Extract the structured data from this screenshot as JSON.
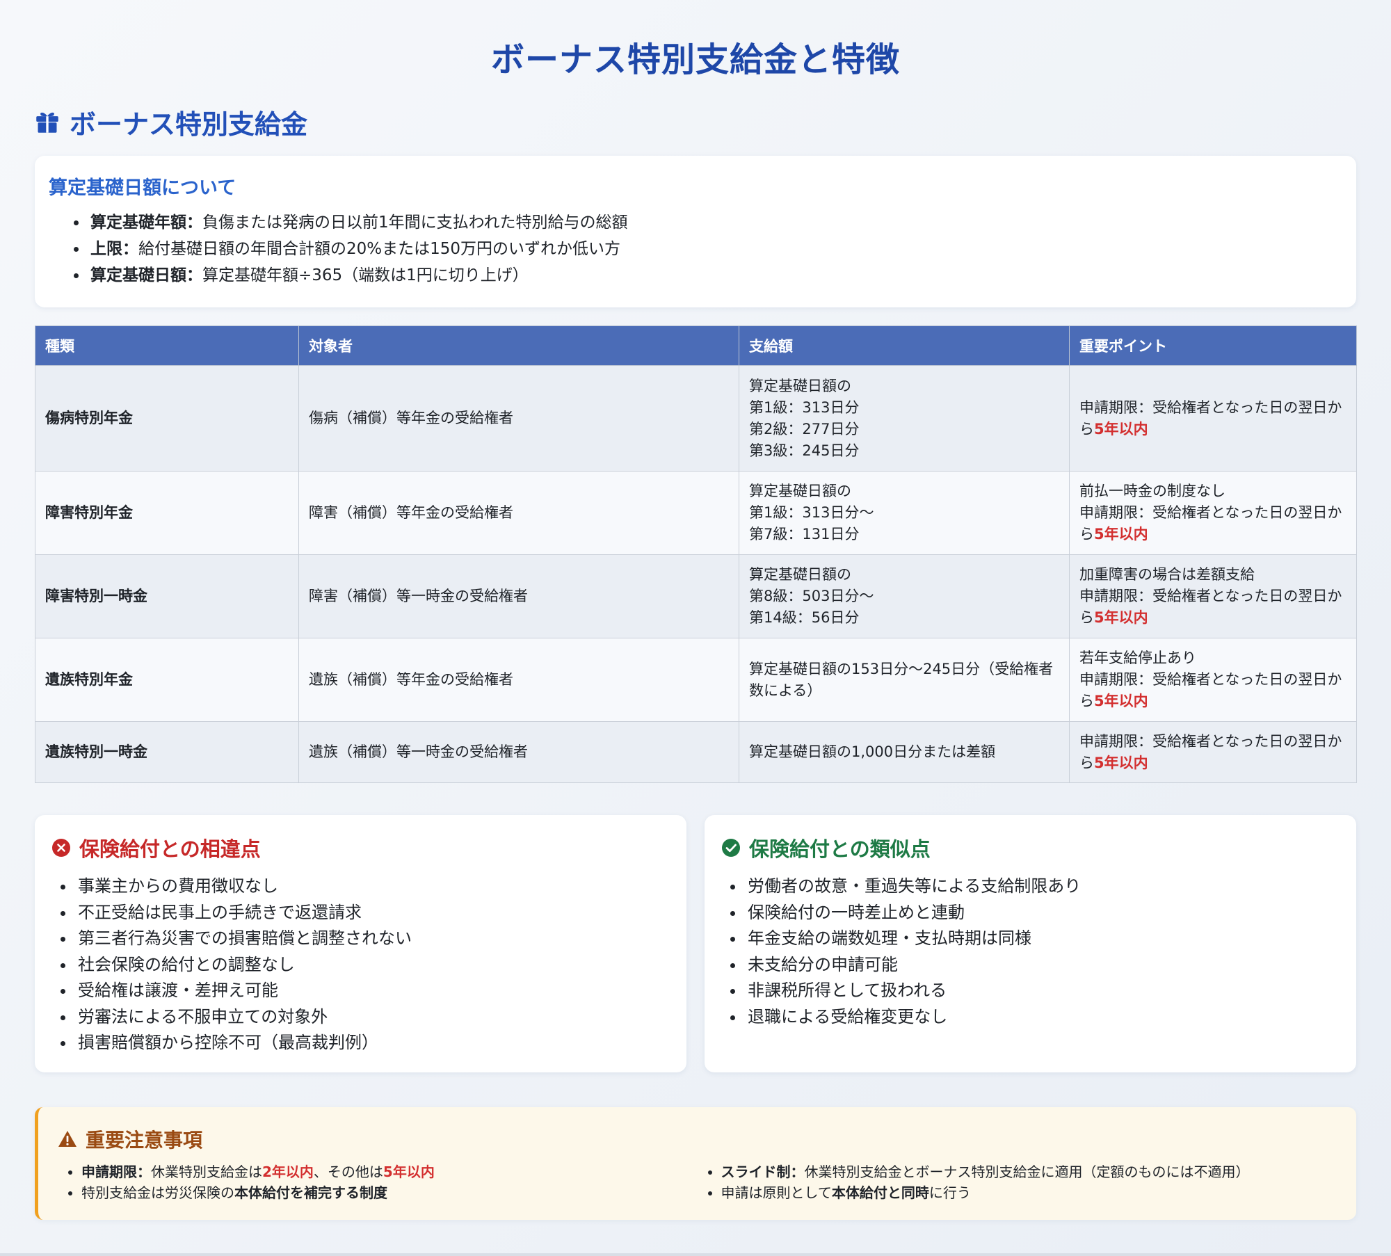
{
  "page_title": "ボーナス特別支給金と特徴",
  "section": {
    "title": "ボーナス特別支給金",
    "icon": "gift-icon"
  },
  "basis": {
    "title": "算定基礎日額について",
    "items": [
      {
        "term": "算定基礎年額",
        "sep": "：",
        "text": "負傷または発病の日以前1年間に支払われた特別給与の総額"
      },
      {
        "term": "上限",
        "sep": "：",
        "text": "給付基礎日額の年間合計額の20%または150万円のいずれか低い方"
      },
      {
        "term": "算定基礎日額",
        "sep": "：",
        "text": "算定基礎年額÷365（端数は1円に切り上げ）"
      }
    ]
  },
  "table": {
    "headers": [
      "種類",
      "対象者",
      "支給額",
      "重要ポイント"
    ],
    "rows": [
      {
        "type": "傷病特別年金",
        "target": "傷病（補償）等年金の受給権者",
        "amount": [
          "算定基礎日額の",
          "第1級：313日分",
          "第2級：277日分",
          "第3級：245日分"
        ],
        "note_lines": [],
        "deadline_prefix": "申請期限：受給権者となった日の翌日から",
        "deadline_value": "5年以内"
      },
      {
        "type": "障害特別年金",
        "target": "障害（補償）等年金の受給権者",
        "amount": [
          "算定基礎日額の",
          "第1級：313日分〜",
          "第7級：131日分"
        ],
        "note_lines": [
          "前払一時金の制度なし"
        ],
        "deadline_prefix": "申請期限：受給権者となった日の翌日から",
        "deadline_value": "5年以内"
      },
      {
        "type": "障害特別一時金",
        "target": "障害（補償）等一時金の受給権者",
        "amount": [
          "算定基礎日額の",
          "第8級：503日分〜",
          "第14級：56日分"
        ],
        "note_lines": [
          "加重障害の場合は差額支給"
        ],
        "deadline_prefix": "申請期限：受給権者となった日の翌日から",
        "deadline_value": "5年以内"
      },
      {
        "type": "遺族特別年金",
        "target": "遺族（補償）等年金の受給権者",
        "amount": [
          "算定基礎日額の153日分〜245日分（受給権者数による）"
        ],
        "note_lines": [
          "若年支給停止あり"
        ],
        "deadline_prefix": "申請期限：受給権者となった日の翌日から",
        "deadline_value": "5年以内"
      },
      {
        "type": "遺族特別一時金",
        "target": "遺族（補償）等一時金の受給権者",
        "amount": [
          "算定基礎日額の1,000日分または差額"
        ],
        "note_lines": [],
        "deadline_prefix": "申請期限：受給権者となった日の翌日から",
        "deadline_value": "5年以内"
      }
    ]
  },
  "differences": {
    "title": "保険給付との相違点",
    "icon": "x-circle-icon",
    "items": [
      "事業主からの費用徴収なし",
      "不正受給は民事上の手続きで返還請求",
      "第三者行為災害での損害賠償と調整されない",
      "社会保険の給付との調整なし",
      "受給権は譲渡・差押え可能",
      "労審法による不服申立ての対象外",
      "損害賠償額から控除不可（最高裁判例）"
    ]
  },
  "similarities": {
    "title": "保険給付との類似点",
    "icon": "check-circle-icon",
    "items": [
      "労働者の故意・重過失等による支給制限あり",
      "保険給付の一時差止めと連動",
      "年金支給の端数処理・支払時期は同様",
      "未支給分の申請可能",
      "非課税所得として扱われる",
      "退職による受給権変更なし"
    ]
  },
  "notice": {
    "title": "重要注意事項",
    "icon": "warning-triangle-icon",
    "items": [
      {
        "term": "申請期限",
        "sep": "：",
        "t1": "休業特別支給金は",
        "r1": "2年以内",
        "t2": "、その他は",
        "r2": "5年以内"
      },
      {
        "term": "スライド制",
        "sep": "：",
        "text": "休業特別支給金とボーナス特別支給金に適用（定額のものには不適用）"
      },
      {
        "pre": "特別支給金は労災保険の",
        "bold": "本体給付を補完する制度",
        "post": ""
      },
      {
        "pre": "申請は原則として",
        "bold": "本体給付と同時",
        "post": "に行う"
      }
    ]
  },
  "colors": {
    "title": "#1e47a8",
    "table_header": "#4b6cb7",
    "red": "#d32f2f",
    "green": "#1e7a45",
    "warn_border": "#f0a020"
  }
}
